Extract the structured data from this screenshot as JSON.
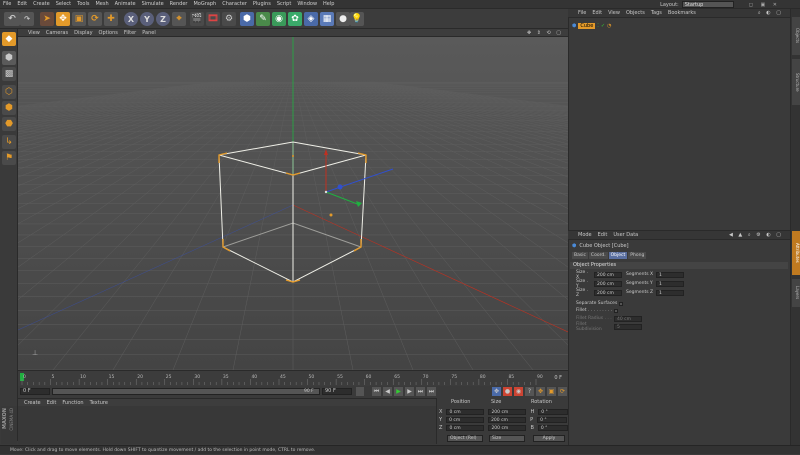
{
  "menubar": {
    "items": [
      "File",
      "Edit",
      "Create",
      "Select",
      "Tools",
      "Mesh",
      "Animate",
      "Simulate",
      "Render",
      "MoGraph",
      "Character",
      "Plugins",
      "Script",
      "Window",
      "Help"
    ],
    "layout_label": "Layout:",
    "layout_value": "Startup"
  },
  "toolbar": {
    "axis_x": "X",
    "axis_y": "Y",
    "axis_z": "Z"
  },
  "viewport_menu": {
    "items": [
      "View",
      "Cameras",
      "Display",
      "Options",
      "Filter",
      "Panel"
    ]
  },
  "timeline": {
    "ticks": [
      "0",
      "5",
      "10",
      "15",
      "20",
      "25",
      "30",
      "35",
      "40",
      "45",
      "50",
      "55",
      "60",
      "65",
      "70",
      "75",
      "80",
      "85",
      "90"
    ],
    "frame_indicator": "0 F"
  },
  "transport": {
    "start_frame": "0 F",
    "end_frame": "90 F",
    "preview_end": "90 F"
  },
  "material_menu": {
    "items": [
      "Create",
      "Edit",
      "Function",
      "Texture"
    ]
  },
  "coords": {
    "headers": [
      "Position",
      "Size",
      "Rotation"
    ],
    "rows": [
      {
        "axis": "X",
        "pos": "0 cm",
        "size": "200 cm",
        "rot_axis": "H",
        "rot": "0 °"
      },
      {
        "axis": "Y",
        "pos": "0 cm",
        "size": "200 cm",
        "rot_axis": "P",
        "rot": "0 °"
      },
      {
        "axis": "Z",
        "pos": "0 cm",
        "size": "200 cm",
        "rot_axis": "B",
        "rot": "0 °"
      }
    ],
    "mode_select": "Object (Rel)",
    "size_select": "Size",
    "apply_label": "Apply"
  },
  "status": {
    "text": "Move: Click and drag to move elements. Hold down SHIFT to quantize movement / add to the selection in point mode, CTRL to remove."
  },
  "object_manager": {
    "menu": [
      "File",
      "Edit",
      "View",
      "Objects",
      "Tags",
      "Bookmarks"
    ],
    "objects": [
      {
        "name": "Cube"
      }
    ]
  },
  "attributes": {
    "menu": [
      "Mode",
      "Edit",
      "User Data"
    ],
    "title": "Cube Object [Cube]",
    "tabs": [
      "Basic",
      "Coord.",
      "Object",
      "Phong"
    ],
    "active_tab": "Object",
    "section": "Object Properties",
    "size_x_label": "Size . X",
    "size_x": "200 cm",
    "size_y_label": "Size . Y",
    "size_y": "200 cm",
    "size_z_label": "Size . Z",
    "size_z": "200 cm",
    "seg_x_label": "Segments X",
    "seg_x": "1",
    "seg_y_label": "Segments Y",
    "seg_y": "1",
    "seg_z_label": "Segments Z",
    "seg_z": "1",
    "separate_label": "Separate Surfaces",
    "fillet_label": "Fillet . . . . . . . . .",
    "fillet_radius_label": "Fillet Radius . . .",
    "fillet_radius": "40 cm",
    "fillet_sub_label": "Fillet Subdivision",
    "fillet_sub": "5"
  },
  "right_tabs": [
    "Objects",
    "Structure",
    "Attributes",
    "Layers"
  ],
  "maxon": {
    "brand": "MAXON",
    "product": "CINEMA 4D"
  },
  "colors": {
    "accent": "#e39a2a",
    "active_tab": "#5a6fa0",
    "viewport_bg": "#4d4d4d",
    "cube_wire": "#f0f0e8",
    "axis_x": "#c03020",
    "axis_y": "#20b040",
    "axis_z": "#3050d0"
  }
}
